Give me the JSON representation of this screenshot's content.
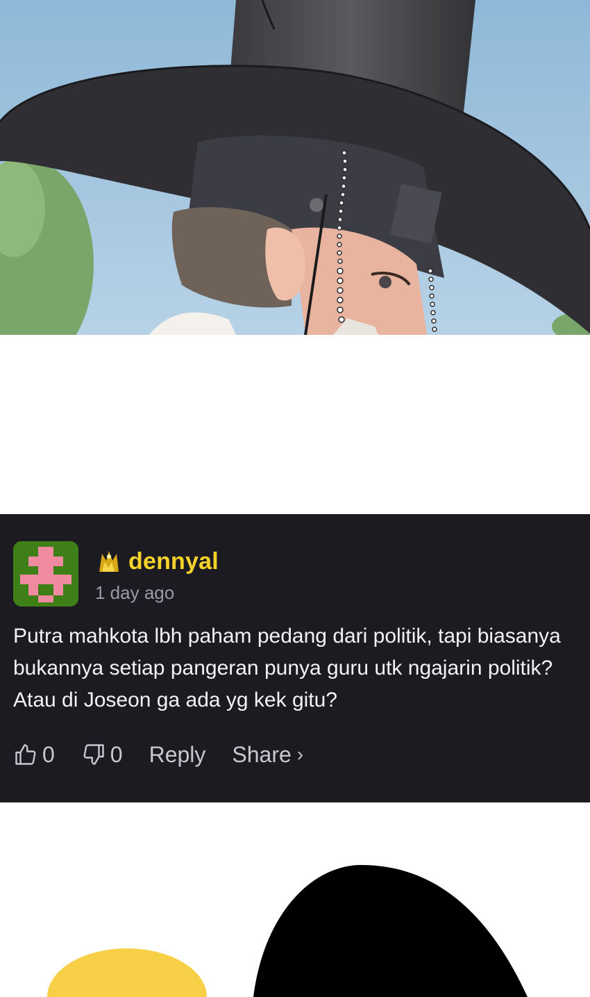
{
  "comment": {
    "username": "dennyal",
    "timestamp": "1 day ago",
    "text": "Putra mahkota lbh paham pedang dari politik, tapi biasanya bukannya setiap pangeran punya guru utk ngajarin politik? Atau di Joseon ga ada yg kek gitu?",
    "likes": "0",
    "dislikes": "0",
    "reply_label": "Reply",
    "share_label": "Share",
    "share_chevron": "›",
    "avatar_icon": "pixel-avatar-icon",
    "badge_icon": "gold-badge-icon",
    "like_icon": "thumbs-up-icon",
    "dislike_icon": "thumbs-down-icon"
  },
  "colors": {
    "card_background": "#1c1b22",
    "username": "#f5d32a",
    "timestamp": "#9b9aa3",
    "text": "#f3f3f5",
    "avatar_bg": "#3f7f17",
    "avatar_pixel": "#f08aa0"
  }
}
